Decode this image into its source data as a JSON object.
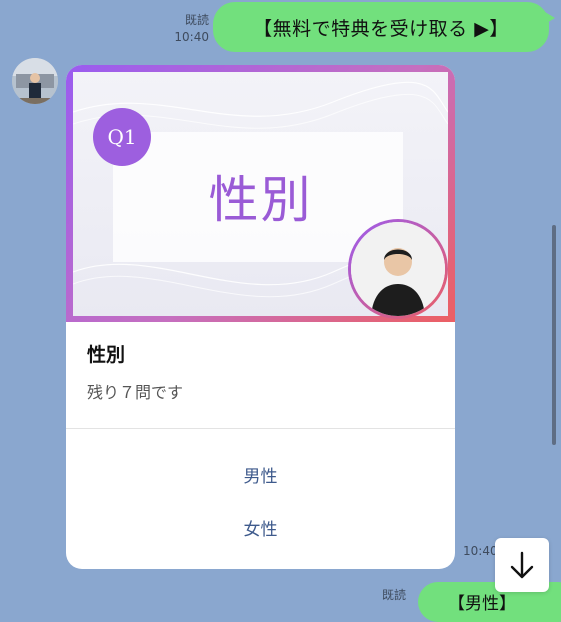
{
  "messages": {
    "outgoing_top": {
      "read_label": "既読",
      "time": "10:40",
      "text": "【無料で特典を受け取る ▶】"
    },
    "card": {
      "badge": "Q1",
      "hero_title": "性別",
      "title": "性別",
      "subtitle": "残り７問です",
      "choices": [
        "男性",
        "女性"
      ]
    },
    "card_time": "10:40",
    "outgoing_bottom": {
      "read_label": "既読",
      "text": "【男性】"
    }
  },
  "icons": {
    "scroll_down": "arrow-down-icon"
  },
  "colors": {
    "background": "#8aa7cf",
    "bubble_green": "#72e07d",
    "accent_purple": "#9a5bd6"
  }
}
